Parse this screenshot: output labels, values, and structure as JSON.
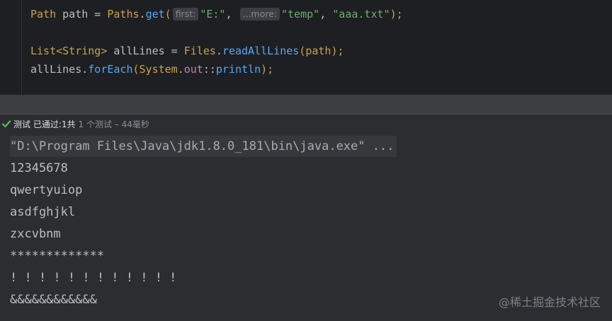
{
  "editor": {
    "line1": {
      "type": "Path",
      "var": " path = ",
      "cls": "Paths",
      "dot": ".",
      "method": "get",
      "open": "(",
      "hint1": "first:",
      "arg1": "\"E:\"",
      "comma1": ", ",
      "hint2": "...more:",
      "arg2": "\"temp\"",
      "comma2": ", ",
      "arg3": "\"aaa.txt\"",
      "close": ");"
    },
    "line2": {
      "type": "List<String>",
      "var": " allLines = ",
      "cls": "Files",
      "dot": ".",
      "method": "readAllLines",
      "args": "(path);"
    },
    "line3": {
      "obj": "allLines",
      "dot": ".",
      "method": "forEach",
      "open": "(",
      "cls": "System",
      "dot2": ".",
      "field": "out",
      "sep": "::",
      "ref": "println",
      "close": ");"
    }
  },
  "status": {
    "label": "测试 已通过:",
    "count": " 1共",
    "detail": "1 个测试 – 44毫秒"
  },
  "console": {
    "command": "\"D:\\Program Files\\Java\\jdk1.8.0_181\\bin\\java.exe\" ...",
    "lines": [
      "12345678",
      "qwertyuiop",
      "asdfghjkl",
      "zxcvbnm",
      "*************",
      "! ! ! ! ! ! ! ! ! ! ! !",
      "&&&&&&&&&&&&"
    ]
  },
  "watermark": "@稀土掘金技术社区"
}
